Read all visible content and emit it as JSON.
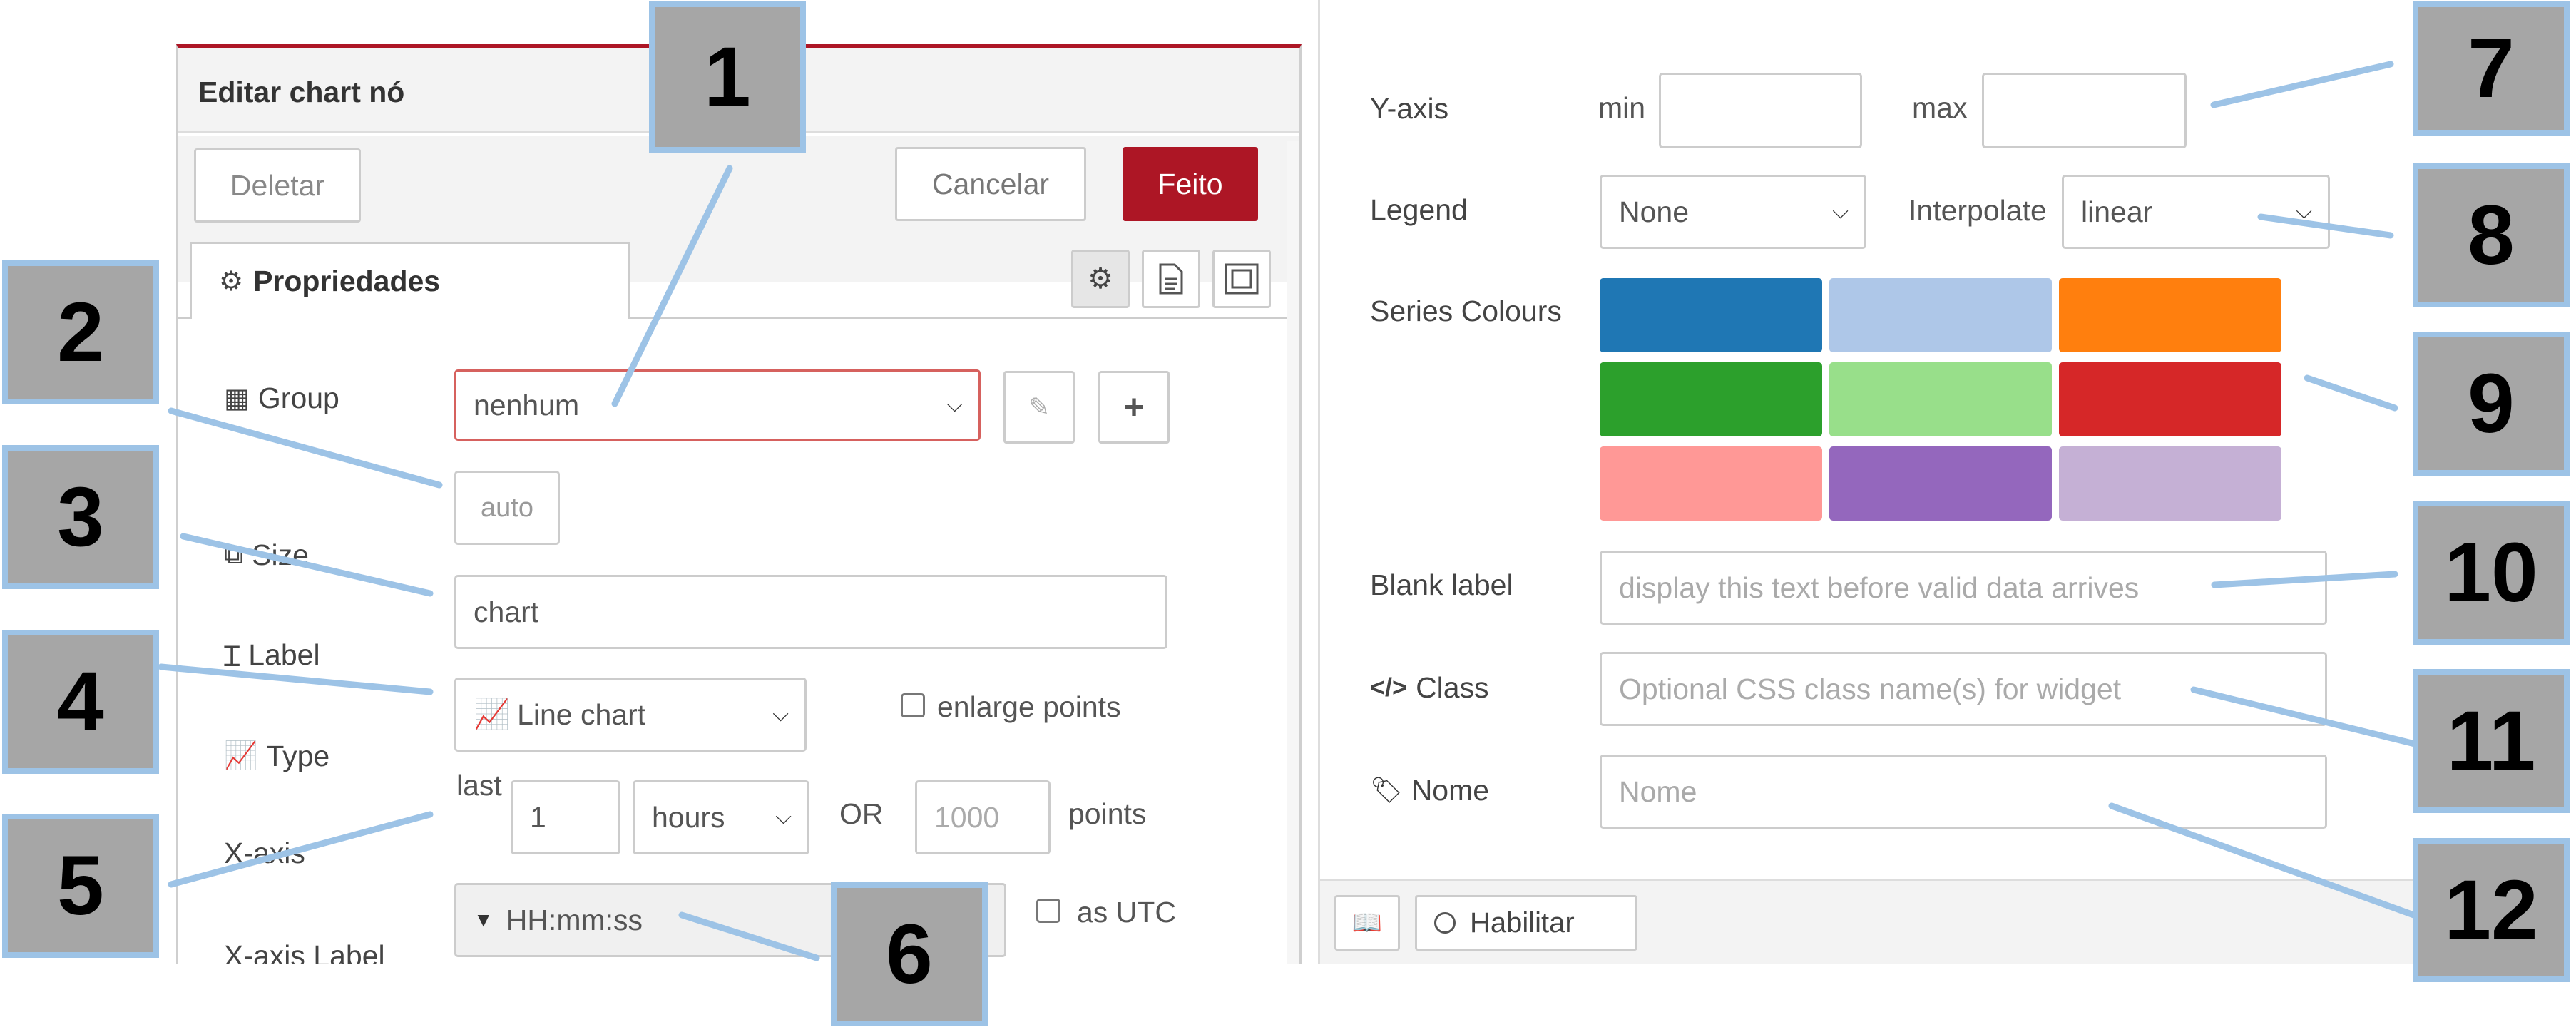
{
  "dialog": {
    "title": "Editar chart nó",
    "buttons": {
      "delete": "Deletar",
      "cancel": "Cancelar",
      "done": "Feito"
    },
    "tab": "Propriedades"
  },
  "fields": {
    "group": {
      "label": "Group",
      "value": "nenhum"
    },
    "size": {
      "label": "Size",
      "value": "auto"
    },
    "label": {
      "label": "Label",
      "value": "chart"
    },
    "type": {
      "label": "Type",
      "value": "Line chart",
      "enlarge_points": "enlarge points"
    },
    "xaxis": {
      "label": "X-axis",
      "last": "last",
      "count": "1",
      "unit": "hours",
      "or": "OR",
      "points_placeholder": "1000",
      "points": "points"
    },
    "xaxis_label": {
      "label": "X-axis Label",
      "value": "HH:mm:ss",
      "utc": "as UTC"
    },
    "yaxis": {
      "label": "Y-axis",
      "min": "min",
      "max": "max"
    },
    "legend": {
      "label": "Legend",
      "value": "None"
    },
    "interpolate": {
      "label": "Interpolate",
      "value": "linear"
    },
    "series_colours": {
      "label": "Series Colours",
      "colors": [
        "#1f77b4",
        "#aec7e8",
        "#ff7f0e",
        "#2ca02c",
        "#98df8a",
        "#d62728",
        "#ff9896",
        "#9467bd",
        "#c5b0d5"
      ]
    },
    "blank_label": {
      "label": "Blank label",
      "placeholder": "display this text before valid data arrives"
    },
    "class": {
      "label": "Class",
      "placeholder": "Optional CSS class name(s) for widget"
    },
    "name": {
      "label": "Nome",
      "placeholder": "Nome"
    }
  },
  "footer": {
    "enable": "Habilitar"
  },
  "callouts": [
    "1",
    "2",
    "3",
    "4",
    "5",
    "6",
    "7",
    "8",
    "9",
    "10",
    "11",
    "12"
  ],
  "accent_color": "#ad1625",
  "callout_border_color": "#9dc3e6"
}
